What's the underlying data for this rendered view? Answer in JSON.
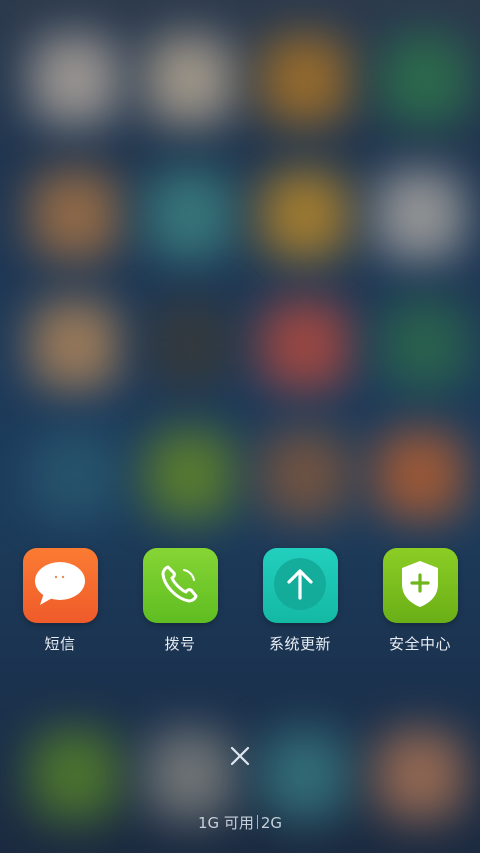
{
  "apps": [
    {
      "label": "短信",
      "icon": "message-bubble-icon",
      "color": "#f26b2f"
    },
    {
      "label": "拨号",
      "icon": "phone-icon",
      "color": "#71c92c"
    },
    {
      "label": "系统更新",
      "icon": "upload-arrow-icon",
      "color": "#19c6b1"
    },
    {
      "label": "安全中心",
      "icon": "shield-plus-icon",
      "color": "#79bd1e"
    }
  ],
  "memory": {
    "available": "1G 可用",
    "total": "2G"
  },
  "close_icon": "close-icon"
}
